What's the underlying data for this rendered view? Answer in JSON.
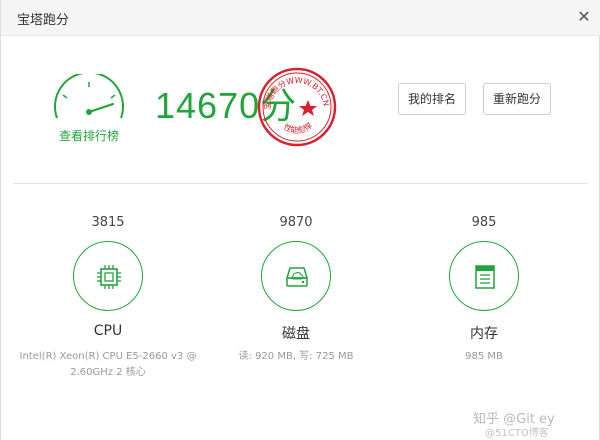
{
  "window": {
    "title": "宝塔跑分",
    "close_icon": "close-icon"
  },
  "summary": {
    "score": "14670分",
    "ranking_link": "查看排行榜",
    "stamp": {
      "top_text": "宝塔跑分WWW.BT.CN",
      "bottom_text": "性能彪悍",
      "color": "#d8212b"
    }
  },
  "buttons": {
    "my_rank": "我的排名",
    "retest": "重新跑分"
  },
  "categories": [
    {
      "score": "3815",
      "name": "CPU",
      "desc_line1": "Intel(R) Xeon(R) CPU E5-2660 v3 @",
      "desc_line2": "2.60GHz 2 核心",
      "icon": "cpu-icon"
    },
    {
      "score": "9870",
      "name": "磁盘",
      "desc_line1": "读: 920 MB, 写: 725 MB",
      "desc_line2": "",
      "icon": "disk-icon"
    },
    {
      "score": "985",
      "name": "内存",
      "desc_line1": "985 MB",
      "desc_line2": "",
      "icon": "memory-icon"
    }
  ],
  "watermark": {
    "line1": "知乎 @Git ey",
    "line2": "@51CTO博客"
  },
  "accent_color": "#20a53a"
}
